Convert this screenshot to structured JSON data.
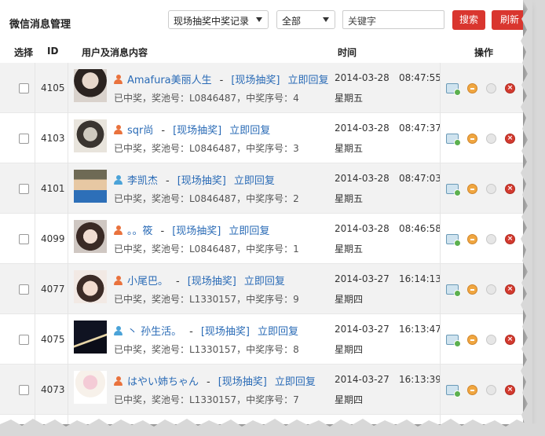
{
  "header": {
    "title": "微信消息管理",
    "filter_selected": "现场抽奖中奖记录",
    "scope_selected": "全部",
    "keyword_placeholder": "关键字",
    "search_label": "搜索",
    "refresh_label": "刷新"
  },
  "columns": {
    "select": "选择",
    "id": "ID",
    "content": "用户及消息内容",
    "time": "时间",
    "ops": "操作"
  },
  "colors": {
    "accent_red": "#d9362f",
    "link_blue": "#2a6bb6",
    "female_icon": "#e9723d",
    "male_icon": "#4ba3d8"
  },
  "rows": [
    {
      "id": "4105",
      "gender": "female",
      "name": "Amafura美丽人生",
      "tag": "[现场抽奖]",
      "reply": "立即回复",
      "detail": "已中奖，奖池号：L0846487，中奖序号：4",
      "date": "2014-03-28",
      "time": "08:47:55",
      "weekday": "星期五"
    },
    {
      "id": "4103",
      "gender": "female",
      "name": "sqr尚",
      "tag": "[现场抽奖]",
      "reply": "立即回复",
      "detail": "已中奖，奖池号：L0846487，中奖序号：3",
      "date": "2014-03-28",
      "time": "08:47:37",
      "weekday": "星期五"
    },
    {
      "id": "4101",
      "gender": "male",
      "name": "李凯杰",
      "tag": "[现场抽奖]",
      "reply": "立即回复",
      "detail": "已中奖，奖池号：L0846487，中奖序号：2",
      "date": "2014-03-28",
      "time": "08:47:03",
      "weekday": "星期五"
    },
    {
      "id": "4099",
      "gender": "female",
      "name": "。。筱",
      "tag": "[现场抽奖]",
      "reply": "立即回复",
      "detail": "已中奖，奖池号：L0846487，中奖序号：1",
      "date": "2014-03-28",
      "time": "08:46:58",
      "weekday": "星期五"
    },
    {
      "id": "4077",
      "gender": "female",
      "name": "小尾巴。",
      "tag": "[现场抽奖]",
      "reply": "立即回复",
      "detail": "已中奖，奖池号：L1330157，中奖序号：9",
      "date": "2014-03-27",
      "time": "16:14:13",
      "weekday": "星期四"
    },
    {
      "id": "4075",
      "gender": "male",
      "name": "丶 孙生活。",
      "tag": "[现场抽奖]",
      "reply": "立即回复",
      "detail": "已中奖，奖池号：L1330157，中奖序号：8",
      "date": "2014-03-27",
      "time": "16:13:47",
      "weekday": "星期四"
    },
    {
      "id": "4073",
      "gender": "female",
      "name": "はやい姉ちゃん",
      "tag": "[现场抽奖]",
      "reply": "立即回复",
      "detail": "已中奖，奖池号：L1330157，中奖序号：7",
      "date": "2014-03-27",
      "time": "16:13:39",
      "weekday": "星期四"
    }
  ]
}
